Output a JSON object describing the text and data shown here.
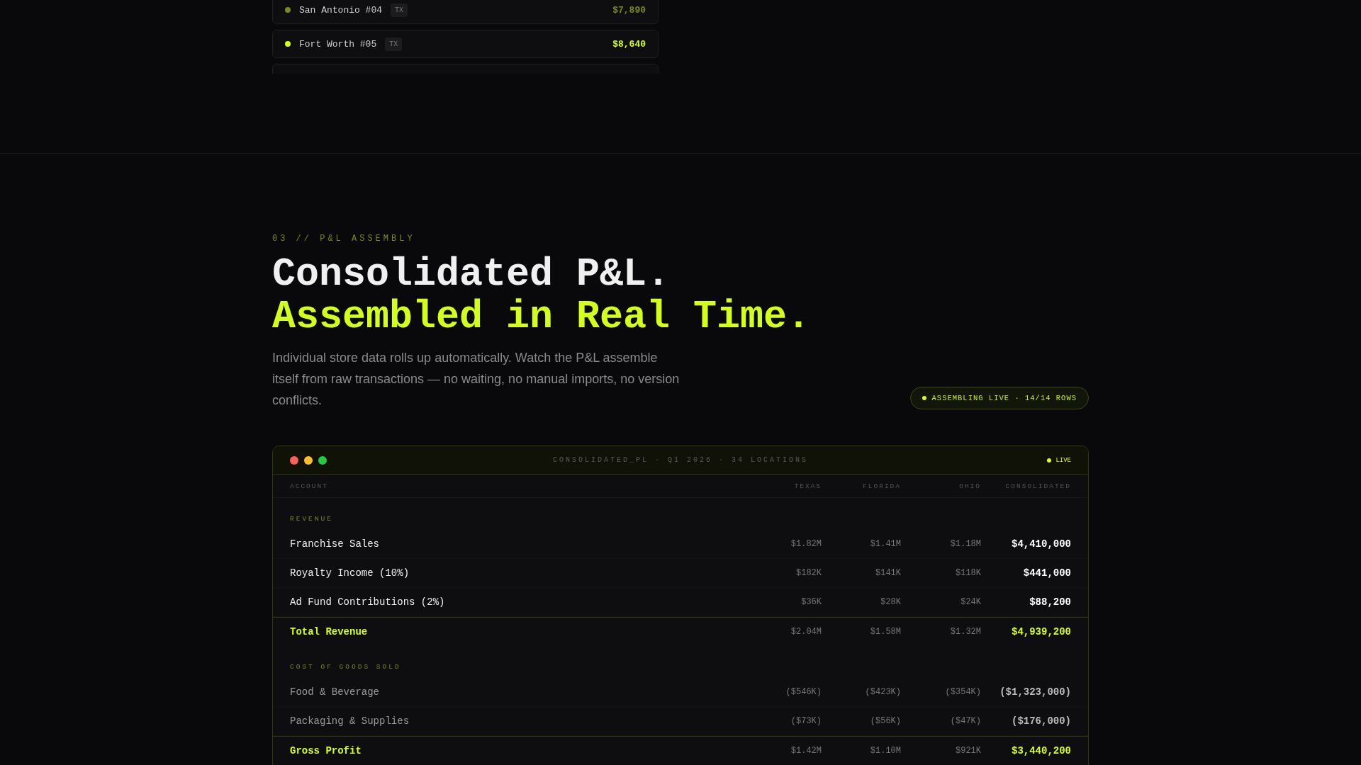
{
  "store_cards": [
    {
      "name": "San Antonio #04",
      "state": "TX",
      "amount": "$7,890",
      "color": "#7a8a1a"
    },
    {
      "name": "Fort Worth #05",
      "state": "TX",
      "amount": "$8,640",
      "color": "#d4ff1a"
    }
  ],
  "section": {
    "eyebrow": "03 // P&L ASSEMBLY",
    "title_line_1": "Consolidated P&L.",
    "title_line_2": "Assembled in Real Time.",
    "description": "Individual store data rolls up automatically. Watch the P&L assemble itself from raw transactions — no waiting, no manual imports, no version conflicts.",
    "badge": "ASSEMBLING LIVE · 14/14 ROWS"
  },
  "table_window": {
    "title": "CONSOLIDATED_PL · Q1 2026 · 34 LOCATIONS",
    "status": "LIVE",
    "columns": [
      "ACCOUNT",
      "TEXAS",
      "FLORIDA",
      "OHIO",
      "CONSOLIDATED"
    ],
    "rows": [
      {
        "kind": "section",
        "account": "REVENUE"
      },
      {
        "kind": "item",
        "account": "Franchise Sales",
        "cells": [
          "$1.82M",
          "$1.41M",
          "$1.18M",
          "$4,410,000"
        ]
      },
      {
        "kind": "item",
        "account": "Royalty Income (10%)",
        "cells": [
          "$182K",
          "$141K",
          "$118K",
          "$441,000"
        ]
      },
      {
        "kind": "item",
        "account": "Ad Fund Contributions (2%)",
        "cells": [
          "$36K",
          "$28K",
          "$24K",
          "$88,200"
        ]
      },
      {
        "kind": "total",
        "account": "Total Revenue",
        "cells": [
          "$2.04M",
          "$1.58M",
          "$1.32M",
          "$4,939,200"
        ]
      },
      {
        "kind": "section",
        "account": "COST OF GOODS SOLD"
      },
      {
        "kind": "cost",
        "account": "Food & Beverage",
        "cells": [
          "($546K)",
          "($423K)",
          "($354K)",
          "($1,323,000)"
        ]
      },
      {
        "kind": "cost",
        "account": "Packaging & Supplies",
        "cells": [
          "($73K)",
          "($56K)",
          "($47K)",
          "($176,000)"
        ]
      },
      {
        "kind": "total",
        "account": "Gross Profit",
        "cells": [
          "$1.42M",
          "$1.10M",
          "$921K",
          "$3,440,200"
        ]
      }
    ]
  }
}
